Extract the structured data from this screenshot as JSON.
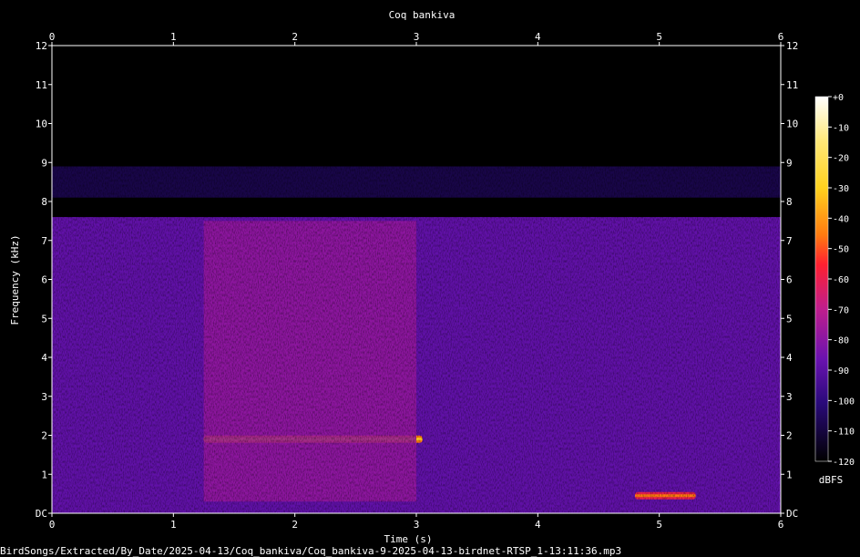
{
  "chart_data": {
    "type": "heatmap",
    "title": "Coq bankiva",
    "xlabel": "Time (s)",
    "ylabel": "Frequency (kHz)",
    "xlim": [
      0,
      6
    ],
    "ylim": [
      0,
      12
    ],
    "x_ticks": [
      "0",
      "1",
      "2",
      "3",
      "4",
      "5",
      "6"
    ],
    "y_ticks": [
      "DC",
      "1",
      "2",
      "3",
      "4",
      "5",
      "6",
      "7",
      "8",
      "9",
      "10",
      "11",
      "12"
    ],
    "colorbar": {
      "label": "dBFS",
      "range": [
        -120,
        0
      ],
      "ticks": [
        "+0",
        "-10",
        "-20",
        "-30",
        "-40",
        "-50",
        "-60",
        "-70",
        "-80",
        "-90",
        "-100",
        "-110",
        "-120"
      ]
    },
    "grid": false,
    "background_noise": {
      "level_dbfs": -88,
      "freq_range_khz": [
        0,
        7.6
      ]
    },
    "faint_band": {
      "level_dbfs": -108,
      "freq_range_khz": [
        8.1,
        8.9
      ]
    },
    "features": [
      {
        "label": "call-harmonic",
        "t_start": 1.25,
        "t_end": 3.05,
        "freq_khz": 1.9,
        "level_dbfs": -45
      },
      {
        "label": "call-energy-band",
        "t_start": 1.25,
        "t_end": 3.0,
        "freq_khz_range": [
          0.3,
          7.5
        ],
        "level_dbfs": -78
      },
      {
        "label": "low-tone",
        "t_start": 4.8,
        "t_end": 5.3,
        "freq_khz": 0.45,
        "level_dbfs": -60
      }
    ],
    "colors": {
      "background": "#000000",
      "cmap_0": "#ffffff",
      "cmap_-30": "#ffd21e",
      "cmap_-50": "#ff2030",
      "cmap_-70": "#c01e8c",
      "cmap_-90": "#420a9a",
      "cmap_-120": "#000000"
    }
  },
  "footer": {
    "path": "BirdSongs/Extracted/By_Date/2025-04-13/Coq_bankiva/Coq_bankiva-9-2025-04-13-birdnet-RTSP_1-13:11:36.mp3"
  }
}
